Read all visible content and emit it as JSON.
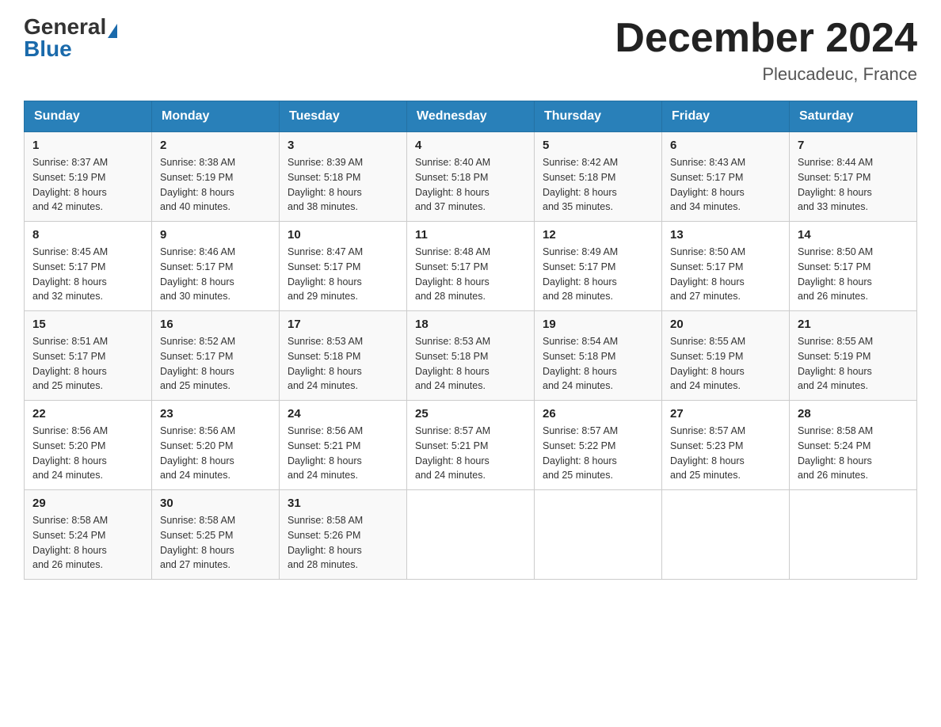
{
  "header": {
    "logo_general": "General",
    "logo_blue": "Blue",
    "month_year": "December 2024",
    "location": "Pleucadeuc, France"
  },
  "days_of_week": [
    "Sunday",
    "Monday",
    "Tuesday",
    "Wednesday",
    "Thursday",
    "Friday",
    "Saturday"
  ],
  "weeks": [
    [
      {
        "day": "1",
        "sunrise": "8:37 AM",
        "sunset": "5:19 PM",
        "daylight": "8 hours and 42 minutes."
      },
      {
        "day": "2",
        "sunrise": "8:38 AM",
        "sunset": "5:19 PM",
        "daylight": "8 hours and 40 minutes."
      },
      {
        "day": "3",
        "sunrise": "8:39 AM",
        "sunset": "5:18 PM",
        "daylight": "8 hours and 38 minutes."
      },
      {
        "day": "4",
        "sunrise": "8:40 AM",
        "sunset": "5:18 PM",
        "daylight": "8 hours and 37 minutes."
      },
      {
        "day": "5",
        "sunrise": "8:42 AM",
        "sunset": "5:18 PM",
        "daylight": "8 hours and 35 minutes."
      },
      {
        "day": "6",
        "sunrise": "8:43 AM",
        "sunset": "5:17 PM",
        "daylight": "8 hours and 34 minutes."
      },
      {
        "day": "7",
        "sunrise": "8:44 AM",
        "sunset": "5:17 PM",
        "daylight": "8 hours and 33 minutes."
      }
    ],
    [
      {
        "day": "8",
        "sunrise": "8:45 AM",
        "sunset": "5:17 PM",
        "daylight": "8 hours and 32 minutes."
      },
      {
        "day": "9",
        "sunrise": "8:46 AM",
        "sunset": "5:17 PM",
        "daylight": "8 hours and 30 minutes."
      },
      {
        "day": "10",
        "sunrise": "8:47 AM",
        "sunset": "5:17 PM",
        "daylight": "8 hours and 29 minutes."
      },
      {
        "day": "11",
        "sunrise": "8:48 AM",
        "sunset": "5:17 PM",
        "daylight": "8 hours and 28 minutes."
      },
      {
        "day": "12",
        "sunrise": "8:49 AM",
        "sunset": "5:17 PM",
        "daylight": "8 hours and 28 minutes."
      },
      {
        "day": "13",
        "sunrise": "8:50 AM",
        "sunset": "5:17 PM",
        "daylight": "8 hours and 27 minutes."
      },
      {
        "day": "14",
        "sunrise": "8:50 AM",
        "sunset": "5:17 PM",
        "daylight": "8 hours and 26 minutes."
      }
    ],
    [
      {
        "day": "15",
        "sunrise": "8:51 AM",
        "sunset": "5:17 PM",
        "daylight": "8 hours and 25 minutes."
      },
      {
        "day": "16",
        "sunrise": "8:52 AM",
        "sunset": "5:17 PM",
        "daylight": "8 hours and 25 minutes."
      },
      {
        "day": "17",
        "sunrise": "8:53 AM",
        "sunset": "5:18 PM",
        "daylight": "8 hours and 24 minutes."
      },
      {
        "day": "18",
        "sunrise": "8:53 AM",
        "sunset": "5:18 PM",
        "daylight": "8 hours and 24 minutes."
      },
      {
        "day": "19",
        "sunrise": "8:54 AM",
        "sunset": "5:18 PM",
        "daylight": "8 hours and 24 minutes."
      },
      {
        "day": "20",
        "sunrise": "8:55 AM",
        "sunset": "5:19 PM",
        "daylight": "8 hours and 24 minutes."
      },
      {
        "day": "21",
        "sunrise": "8:55 AM",
        "sunset": "5:19 PM",
        "daylight": "8 hours and 24 minutes."
      }
    ],
    [
      {
        "day": "22",
        "sunrise": "8:56 AM",
        "sunset": "5:20 PM",
        "daylight": "8 hours and 24 minutes."
      },
      {
        "day": "23",
        "sunrise": "8:56 AM",
        "sunset": "5:20 PM",
        "daylight": "8 hours and 24 minutes."
      },
      {
        "day": "24",
        "sunrise": "8:56 AM",
        "sunset": "5:21 PM",
        "daylight": "8 hours and 24 minutes."
      },
      {
        "day": "25",
        "sunrise": "8:57 AM",
        "sunset": "5:21 PM",
        "daylight": "8 hours and 24 minutes."
      },
      {
        "day": "26",
        "sunrise": "8:57 AM",
        "sunset": "5:22 PM",
        "daylight": "8 hours and 25 minutes."
      },
      {
        "day": "27",
        "sunrise": "8:57 AM",
        "sunset": "5:23 PM",
        "daylight": "8 hours and 25 minutes."
      },
      {
        "day": "28",
        "sunrise": "8:58 AM",
        "sunset": "5:24 PM",
        "daylight": "8 hours and 26 minutes."
      }
    ],
    [
      {
        "day": "29",
        "sunrise": "8:58 AM",
        "sunset": "5:24 PM",
        "daylight": "8 hours and 26 minutes."
      },
      {
        "day": "30",
        "sunrise": "8:58 AM",
        "sunset": "5:25 PM",
        "daylight": "8 hours and 27 minutes."
      },
      {
        "day": "31",
        "sunrise": "8:58 AM",
        "sunset": "5:26 PM",
        "daylight": "8 hours and 28 minutes."
      },
      null,
      null,
      null,
      null
    ]
  ],
  "labels": {
    "sunrise": "Sunrise:",
    "sunset": "Sunset:",
    "daylight": "Daylight:"
  }
}
